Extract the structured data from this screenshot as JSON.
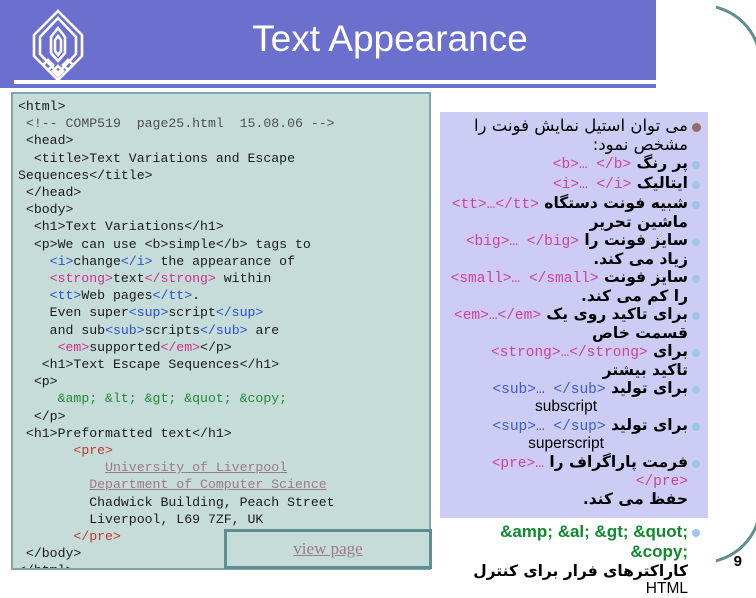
{
  "header": {
    "title": "Text Appearance",
    "logo_icon": "university-crest-logo",
    "background_color": "#6b6fce"
  },
  "page_number": "9",
  "code_panel": {
    "name": "html-source-code-listing",
    "background_color": "#c6dcd9",
    "border_color": "#7fa9a6",
    "lines": [
      [
        {
          "t": "<html>",
          "c": "plain"
        }
      ],
      [
        {
          "t": " <!-- COMP519  page25.html  15.08.06 -->",
          "c": "cmt"
        }
      ],
      [
        {
          "t": " <head>",
          "c": "plain"
        }
      ],
      [
        {
          "t": "  <title>Text Variations and Escape",
          "c": "plain"
        }
      ],
      [
        {
          "t": "Sequences</title>",
          "c": "plain"
        }
      ],
      [
        {
          "t": " </head>",
          "c": "plain"
        }
      ],
      [
        {
          "t": " <body>",
          "c": "plain"
        }
      ],
      [
        {
          "t": "  <h1>Text Variations</h1>",
          "c": "plain"
        }
      ],
      [
        {
          "t": "  <p>We can use ",
          "c": "plain"
        },
        {
          "t": "<b>",
          "c": "plain"
        },
        {
          "t": "simple",
          "c": "plain"
        },
        {
          "t": "</b>",
          "c": "plain"
        },
        {
          "t": " tags to",
          "c": "plain"
        }
      ],
      [
        {
          "t": "    ",
          "c": "plain"
        },
        {
          "t": "<i>",
          "c": "blue"
        },
        {
          "t": "change",
          "c": "plain"
        },
        {
          "t": "</i>",
          "c": "blue"
        },
        {
          "t": " the appearance of",
          "c": "plain"
        }
      ],
      [
        {
          "t": "    ",
          "c": "plain"
        },
        {
          "t": "<strong>",
          "c": "mag"
        },
        {
          "t": "text",
          "c": "plain"
        },
        {
          "t": "</strong>",
          "c": "mag"
        },
        {
          "t": " within",
          "c": "plain"
        }
      ],
      [
        {
          "t": "    ",
          "c": "plain"
        },
        {
          "t": "<tt>",
          "c": "blue"
        },
        {
          "t": "Web pages",
          "c": "plain"
        },
        {
          "t": "</tt>",
          "c": "blue"
        },
        {
          "t": ".",
          "c": "plain"
        }
      ],
      [
        {
          "t": "    Even super",
          "c": "plain"
        },
        {
          "t": "<sup>",
          "c": "blue"
        },
        {
          "t": "script",
          "c": "plain"
        },
        {
          "t": "</sup>",
          "c": "blue"
        }
      ],
      [
        {
          "t": "    and sub",
          "c": "plain"
        },
        {
          "t": "<sub>",
          "c": "blue"
        },
        {
          "t": "scripts",
          "c": "plain"
        },
        {
          "t": "</sub>",
          "c": "blue"
        },
        {
          "t": " are",
          "c": "plain"
        }
      ],
      [
        {
          "t": "     ",
          "c": "plain"
        },
        {
          "t": "<em>",
          "c": "mag"
        },
        {
          "t": "supported",
          "c": "plain"
        },
        {
          "t": "</em>",
          "c": "mag"
        },
        {
          "t": "</p>",
          "c": "plain"
        }
      ],
      [
        {
          "t": "   <h1>Text Escape Sequences</h1>",
          "c": "plain"
        }
      ],
      [
        {
          "t": "  <p>",
          "c": "plain"
        }
      ],
      [
        {
          "t": "     ",
          "c": "plain"
        },
        {
          "t": "&amp; &lt; &gt; &quot; &copy;",
          "c": "grn"
        }
      ],
      [
        {
          "t": "  </p>",
          "c": "plain"
        }
      ],
      [
        {
          "t": " <h1>Preformatted text</h1>",
          "c": "plain"
        }
      ],
      [
        {
          "t": "       ",
          "c": "plain"
        },
        {
          "t": "<pre>",
          "c": "red"
        }
      ],
      [
        {
          "t": "           ",
          "c": "plain"
        },
        {
          "t": "University of Liverpool",
          "c": "lnk"
        }
      ],
      [
        {
          "t": "         ",
          "c": "plain"
        },
        {
          "t": "Department of Computer Science",
          "c": "lnk"
        }
      ],
      [
        {
          "t": "         Chadwick Building, Peach Street",
          "c": "plain"
        }
      ],
      [
        {
          "t": "         Liverpool, L69 7ZF, UK",
          "c": "plain"
        }
      ],
      [
        {
          "t": "       ",
          "c": "plain"
        },
        {
          "t": "</pre>",
          "c": "red"
        }
      ],
      [
        {
          "t": " </body>",
          "c": "plain"
        }
      ],
      [
        {
          "t": "</html>",
          "c": "plain"
        }
      ]
    ]
  },
  "view_page_button": {
    "label": "view page"
  },
  "content_panel": {
    "background_color": "#ccccf5",
    "intro": {
      "line1": "می توان استیل  نمایش فونت را",
      "line2": "مشخص نمود:"
    },
    "items": [
      {
        "tag": "<b>… </b>",
        "tag_color": "magenta",
        "text": "پر رنگ",
        "cont": ""
      },
      {
        "tag": "<i>… </i>",
        "tag_color": "magenta",
        "text": "ایتالیک",
        "cont": ""
      },
      {
        "tag": "<tt>…</tt>",
        "tag_color": "magenta",
        "text": "شبیه فونت دستگاه",
        "cont": "ماشین تحریر"
      },
      {
        "tag": "<big>… </big>",
        "tag_color": "magenta",
        "text": "سایز فونت را",
        "cont": "زیاد می کند."
      },
      {
        "tag": "<small>… </small>",
        "tag_color": "magenta",
        "text": "سایز فونت",
        "cont": "را کم می کند."
      },
      {
        "tag": "<em>…</em>",
        "tag_color": "magenta",
        "text": "برای تاکید روی یک",
        "cont": "قسمت خاص"
      },
      {
        "tag": "<strong>…</strong>",
        "tag_color": "magenta",
        "text": "برای",
        "cont": "تاکید بیشتر"
      },
      {
        "tag": "<sub>… </sub>",
        "tag_color": "blue",
        "text": "برای تولید",
        "cont": "subscript",
        "cont_en": true
      },
      {
        "tag": "<sup>… </sup>",
        "tag_color": "blue",
        "text": "برای تولید",
        "cont": "superscript",
        "cont_en": true
      },
      {
        "tag": "<pre>…</pre>",
        "tag_color": "magenta",
        "text": "فرمت پاراگراف را",
        "cont": "حفظ می کند."
      }
    ],
    "escape_item": {
      "code": "&amp; &al; &gt; &quot; &copy;",
      "text_fa": "کاراکترهای فرار برای کنترل",
      "text_en": "HTML"
    }
  }
}
